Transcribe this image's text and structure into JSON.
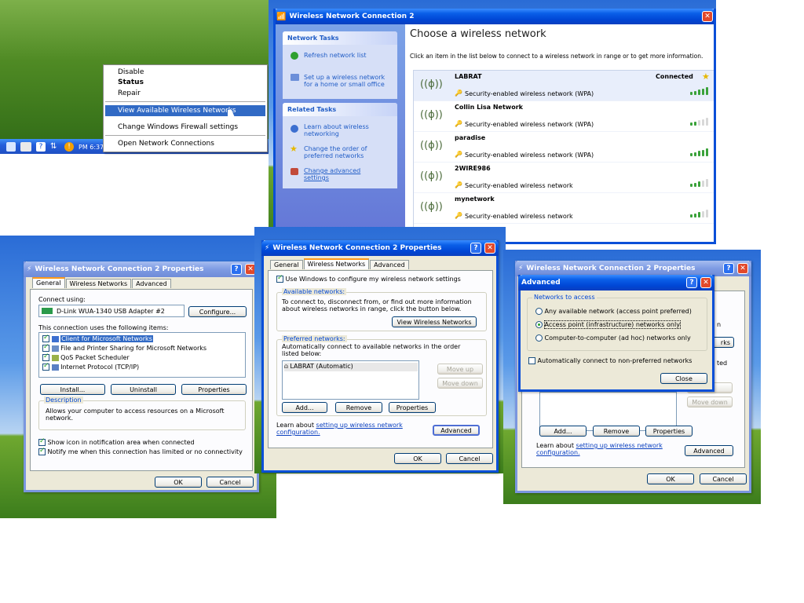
{
  "context_menu": {
    "items": [
      "Disable",
      "Status",
      "Repair",
      "View Available Wireless Networks",
      "Change Windows Firewall settings",
      "Open Network Connections"
    ],
    "highlighted_index": 3,
    "bold_index": 1
  },
  "taskbar": {
    "label": "PM 6:37"
  },
  "wireless_window": {
    "title": "Wireless Network Connection 2",
    "network_tasks": {
      "header": "Network Tasks",
      "items": [
        "Refresh network list",
        "Set up a wireless network for a home or small office"
      ]
    },
    "related_tasks": {
      "header": "Related Tasks",
      "items": [
        "Learn about wireless networking",
        "Change the order of preferred networks",
        "Change advanced settings"
      ]
    },
    "heading": "Choose a wireless network",
    "instructions": "Click an item in the list below to connect to a wireless network in range or to get more information.",
    "networks": [
      {
        "name": "LABRAT",
        "security": "Security-enabled wireless network (WPA)",
        "status": "Connected",
        "signal": 5,
        "selected": true
      },
      {
        "name": "Collin Lisa Network",
        "security": "Security-enabled wireless network (WPA)",
        "status": "",
        "signal": 2,
        "selected": false
      },
      {
        "name": "paradise",
        "security": "Security-enabled wireless network (WPA)",
        "status": "",
        "signal": 5,
        "selected": false
      },
      {
        "name": "2WIRE986",
        "security": "Security-enabled wireless network",
        "status": "",
        "signal": 3,
        "selected": false
      },
      {
        "name": "mynetwork",
        "security": "Security-enabled wireless network",
        "status": "",
        "signal": 3,
        "selected": false
      }
    ]
  },
  "props_general": {
    "title": "Wireless Network Connection 2 Properties",
    "tabs": [
      "General",
      "Wireless Networks",
      "Advanced"
    ],
    "connect_using_label": "Connect using:",
    "adapter": "D-Link WUA-1340 USB Adapter #2",
    "configure_button": "Configure...",
    "items_label": "This connection uses the following items:",
    "items": [
      "Client for Microsoft Networks",
      "File and Printer Sharing for Microsoft Networks",
      "QoS Packet Scheduler",
      "Internet Protocol (TCP/IP)"
    ],
    "install_button": "Install...",
    "uninstall_button": "Uninstall",
    "properties_button": "Properties",
    "description_label": "Description",
    "description": "Allows your computer to access resources on a Microsoft network.",
    "show_icon": "Show icon in notification area when connected",
    "notify": "Notify me when this connection has limited or no connectivity",
    "ok": "OK",
    "cancel": "Cancel"
  },
  "props_wireless": {
    "title": "Wireless Network Connection 2 Properties",
    "tabs": [
      "General",
      "Wireless Networks",
      "Advanced"
    ],
    "use_windows": "Use Windows to configure my wireless network settings",
    "available_label": "Available networks:",
    "available_text": "To connect to, disconnect from, or find out more information about wireless networks in range, click the button below.",
    "view_button": "View Wireless Networks",
    "preferred_label": "Preferred networks:",
    "preferred_text": "Automatically connect to available networks in the order listed below:",
    "preferred_item": "LABRAT (Automatic)",
    "move_up": "Move up",
    "move_down": "Move down",
    "add": "Add...",
    "remove": "Remove",
    "properties": "Properties",
    "learn_prefix": "Learn about",
    "learn_link": "setting up wireless network",
    "learn_suffix": "configuration.",
    "advanced_button": "Advanced",
    "ok": "OK",
    "cancel": "Cancel"
  },
  "advanced_dialog": {
    "back_title": "Wireless Network Connection 2 Properties",
    "title": "Advanced",
    "group_label": "Networks to access",
    "options": [
      "Any available network (access point preferred)",
      "Access point (infrastructure) networks only",
      "Computer-to-computer (ad hoc) networks only"
    ],
    "selected_option": 1,
    "auto_connect": "Automatically connect to non-preferred networks",
    "close": "Close",
    "back_peek_1": "n",
    "back_peek_2": "rks",
    "back_peek_3": "ted",
    "move_down": "Move down",
    "add": "Add...",
    "remove": "Remove",
    "properties": "Properties",
    "learn_prefix": "Learn about",
    "learn_link": "setting up wireless network",
    "learn_suffix": "configuration.",
    "advanced_button": "Advanced",
    "ok": "OK",
    "cancel": "Cancel"
  }
}
